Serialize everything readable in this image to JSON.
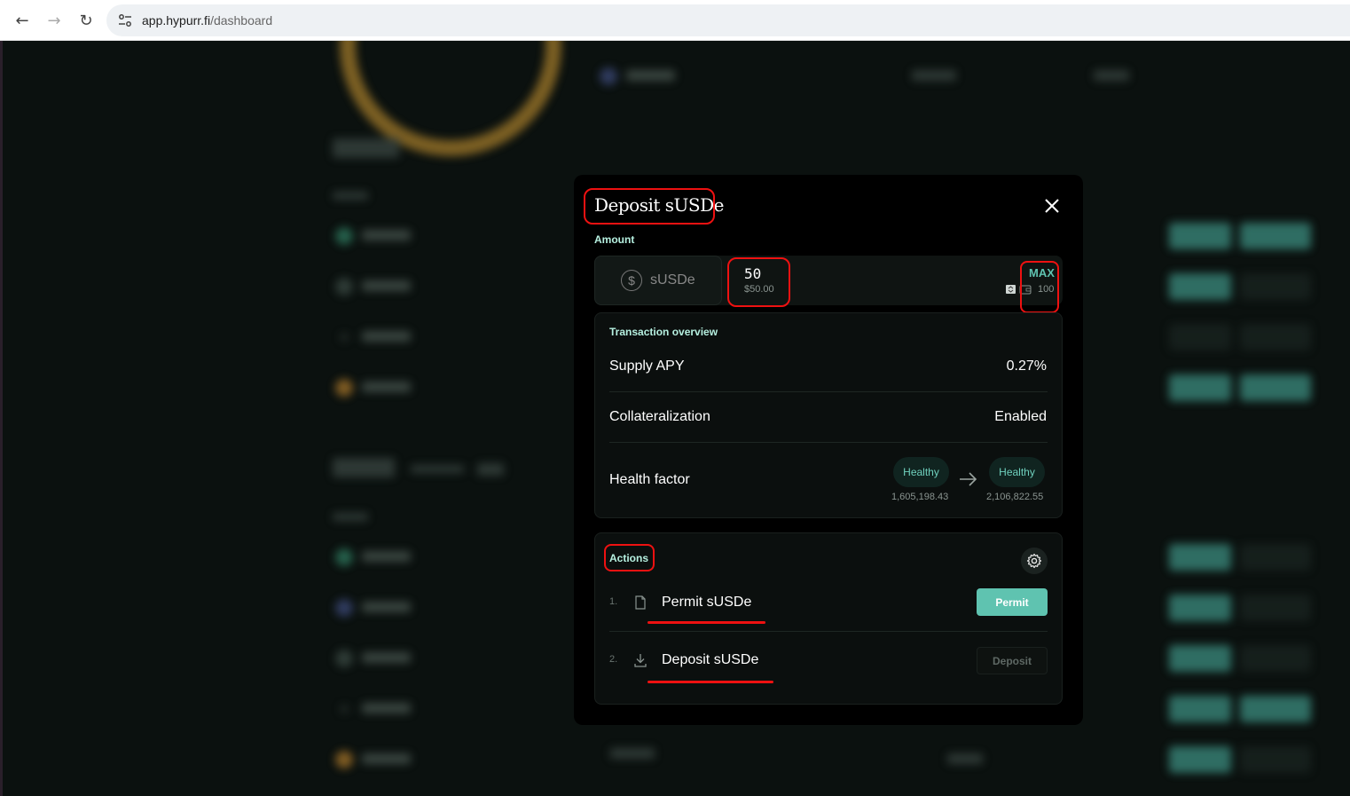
{
  "browser": {
    "url_host": "app.hypurr.fi",
    "url_path": "/dashboard"
  },
  "modal": {
    "title": "Deposit sUSDe",
    "amount_label": "Amount",
    "token": {
      "symbol": "sUSDe",
      "icon": "dollar-coin-icon"
    },
    "amount_value": "50",
    "amount_usd": "$50.00",
    "max_label": "MAX",
    "balance": "100",
    "overview": {
      "title": "Transaction overview",
      "supply_apy_label": "Supply APY",
      "supply_apy_value": "0.27%",
      "collateralization_label": "Collateralization",
      "collateralization_value": "Enabled",
      "health_factor_label": "Health factor",
      "hf_before_status": "Healthy",
      "hf_before_value": "1,605,198.43",
      "hf_after_status": "Healthy",
      "hf_after_value": "2,106,822.55"
    },
    "actions": {
      "title": "Actions",
      "steps": [
        {
          "num": "1.",
          "label": "Permit sUSDe",
          "button": "Permit",
          "icon": "document-icon"
        },
        {
          "num": "2.",
          "label": "Deposit sUSDe",
          "button": "Deposit",
          "icon": "download-icon"
        }
      ]
    }
  },
  "colors": {
    "accent": "#5fc3b0",
    "section_label": "#b6f0e0",
    "annotation_red": "#ee1111",
    "modal_bg": "#000000"
  }
}
